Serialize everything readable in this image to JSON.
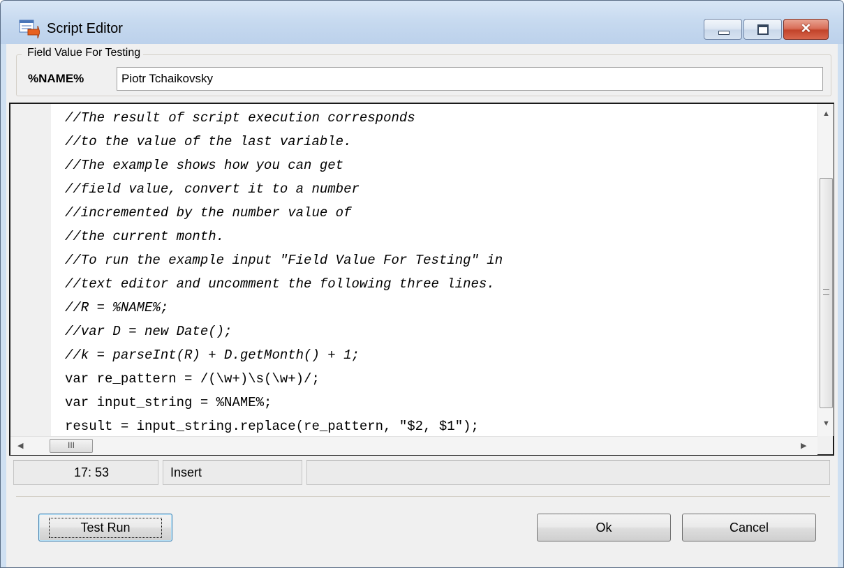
{
  "window": {
    "title": "Script Editor",
    "icon": "script-editor-icon",
    "controls": {
      "minimize": "minimize-icon",
      "maximize": "maximize-icon",
      "close": "close-icon"
    },
    "close_glyph": "✕"
  },
  "testing": {
    "group_label": "Field Value For Testing",
    "variable_label": "%NAME%",
    "value": "Piotr Tchaikovsky"
  },
  "editor": {
    "lines": [
      {
        "text": "//The result of script execution corresponds",
        "kind": "comment"
      },
      {
        "text": "//to the value of the last variable.",
        "kind": "comment"
      },
      {
        "text": "//The example shows how you can get",
        "kind": "comment"
      },
      {
        "text": "//field value, convert it to a number",
        "kind": "comment"
      },
      {
        "text": "//incremented by the number value of",
        "kind": "comment"
      },
      {
        "text": "//the current month.",
        "kind": "comment"
      },
      {
        "text": "//To run the example input \"Field Value For Testing\" in",
        "kind": "comment"
      },
      {
        "text": "//text editor and uncomment the following three lines.",
        "kind": "comment"
      },
      {
        "text": "//R = %NAME%;",
        "kind": "comment"
      },
      {
        "text": "//var D = new Date();",
        "kind": "comment"
      },
      {
        "text": "//k = parseInt(R) + D.getMonth() + 1;",
        "kind": "comment"
      },
      {
        "text": "var re_pattern = /(\\w+)\\s(\\w+)/;",
        "kind": "code"
      },
      {
        "text": "var input_string = %NAME%;",
        "kind": "code"
      },
      {
        "text": "result = input_string.replace(re_pattern, \"$2, $1\");",
        "kind": "code"
      }
    ],
    "hscroll_grip": "III"
  },
  "status": {
    "position": "17: 53",
    "mode": "Insert",
    "extra": ""
  },
  "buttons": {
    "test_run": "Test Run",
    "ok": "Ok",
    "cancel": "Cancel"
  }
}
